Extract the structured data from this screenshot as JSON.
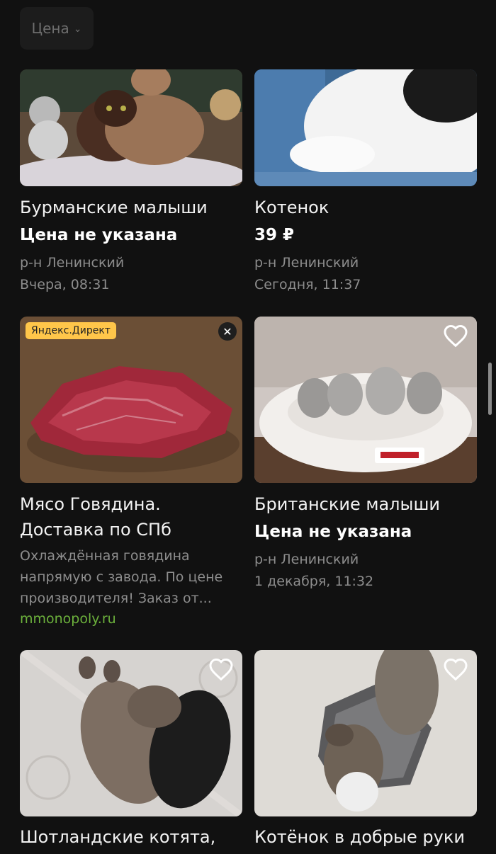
{
  "filter": {
    "price_label": "Цена"
  },
  "listings": [
    {
      "title": "Бурманские малыши",
      "price": "Цена не указана",
      "district": "р-н Ленинский",
      "date": "Вчера, 08:31"
    },
    {
      "title": "Котенок",
      "price": "39 ₽",
      "district": "р-н Ленинский",
      "date": "Сегодня, 11:37"
    },
    {
      "badge": "Яндекс.Директ",
      "title_line1": "Мясо Говядина.",
      "title_line2": "Доставка по СПб",
      "desc_line1": "Охлаждённая говядина",
      "desc_line2": "напрямую с завода. По цене",
      "desc_line3": "производителя! Заказ от...",
      "link": "mmonopoly.ru"
    },
    {
      "title": "Британские малыши",
      "price": "Цена не указана",
      "district": "р-н Ленинский",
      "date": "1 декабря, 11:32"
    },
    {
      "title": "Шотландские котята,"
    },
    {
      "title": "Котёнок в добрые руки"
    }
  ],
  "colors": {
    "background": "#111111",
    "ad_badge": "#ffc64a",
    "link": "#6cb13c",
    "meta_text": "#8d8d8d"
  },
  "icons": [
    "chevron-down-icon",
    "heart-icon",
    "close-icon"
  ]
}
